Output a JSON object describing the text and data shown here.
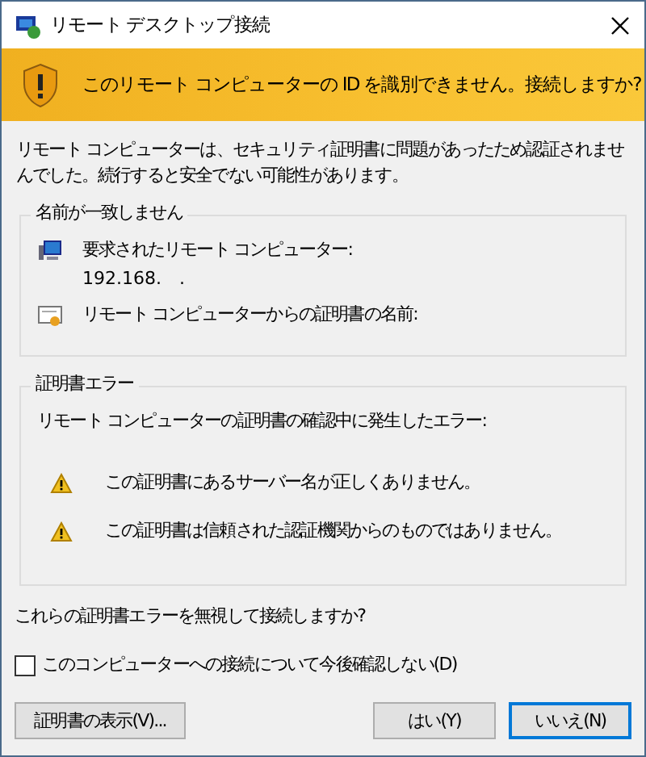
{
  "window": {
    "title": "リモート デスクトップ接続"
  },
  "banner": {
    "text": "このリモート コンピューターの ID を識別できません。接続しますか?"
  },
  "description": "リモート コンピューターは、セキュリティ証明書に問題があったため認証されませんでした。続行すると安全でない可能性があります。",
  "name_mismatch": {
    "title": "名前が一致しません",
    "items": [
      {
        "kind": "computer",
        "label": "要求されたリモート コンピューター:",
        "value": "192.168.　."
      },
      {
        "kind": "certificate",
        "label": "リモート コンピューターからの証明書の名前:"
      }
    ]
  },
  "certificate_errors": {
    "title": "証明書エラー",
    "intro": "リモート コンピューターの証明書の確認中に発生したエラー:",
    "errors": [
      "この証明書にあるサーバー名が正しくありません。",
      "この証明書は信頼された認証機関からのものではありません。"
    ]
  },
  "question": "これらの証明書エラーを無視して接続しますか?",
  "checkbox": {
    "label": "このコンピューターへの接続について今後確認しない(D)",
    "checked": false
  },
  "buttons": [
    {
      "label": "証明書の表示(V)...",
      "default": false
    },
    {
      "label": "はい(Y)",
      "default": false
    },
    {
      "label": "いいえ(N)",
      "default": true
    }
  ]
}
